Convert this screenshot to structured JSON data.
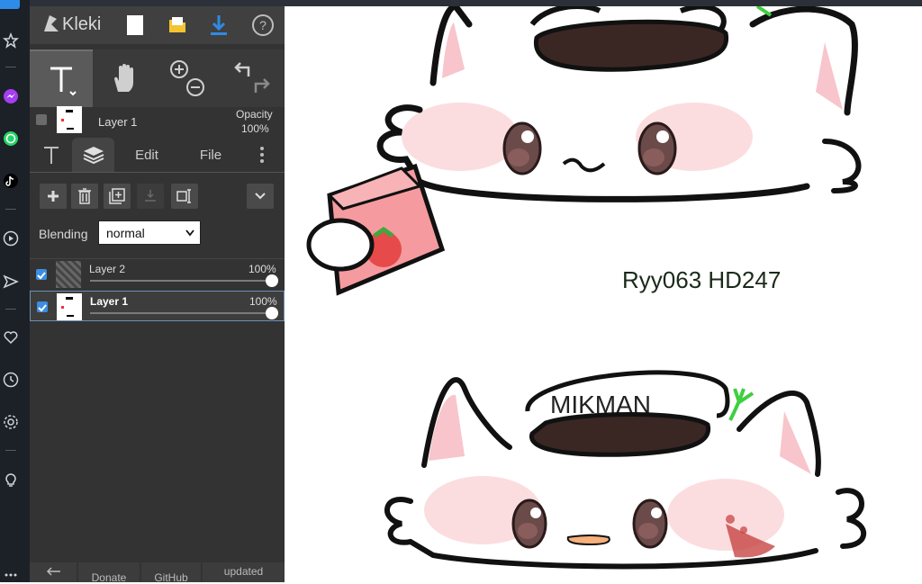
{
  "app": {
    "logo_text": "Kleki"
  },
  "tools_panel": {
    "current_layer_label": "Layer 1",
    "opacity_label": "Opacity",
    "opacity_value": "100%"
  },
  "tabs": {
    "edit": "Edit",
    "file": "File"
  },
  "layers_panel": {
    "blending_label": "Blending",
    "blending_value": "normal",
    "layers": [
      {
        "name": "Layer 2",
        "opacity": "100%",
        "opacity_level": 1.0,
        "visible": true,
        "selected": false
      },
      {
        "name": "Layer 1",
        "opacity": "100%",
        "opacity_level": 1.0,
        "visible": true,
        "selected": true
      }
    ]
  },
  "footer": {
    "donate": "Donate",
    "github": "GitHub",
    "updated": "updated"
  },
  "canvas": {
    "signature_text": "Ryy063 HD247"
  },
  "colors": {
    "panel_bg": "#333333",
    "accent": "#3b8ee0",
    "download": "#2e8ae6",
    "folder": "#f4c430"
  }
}
